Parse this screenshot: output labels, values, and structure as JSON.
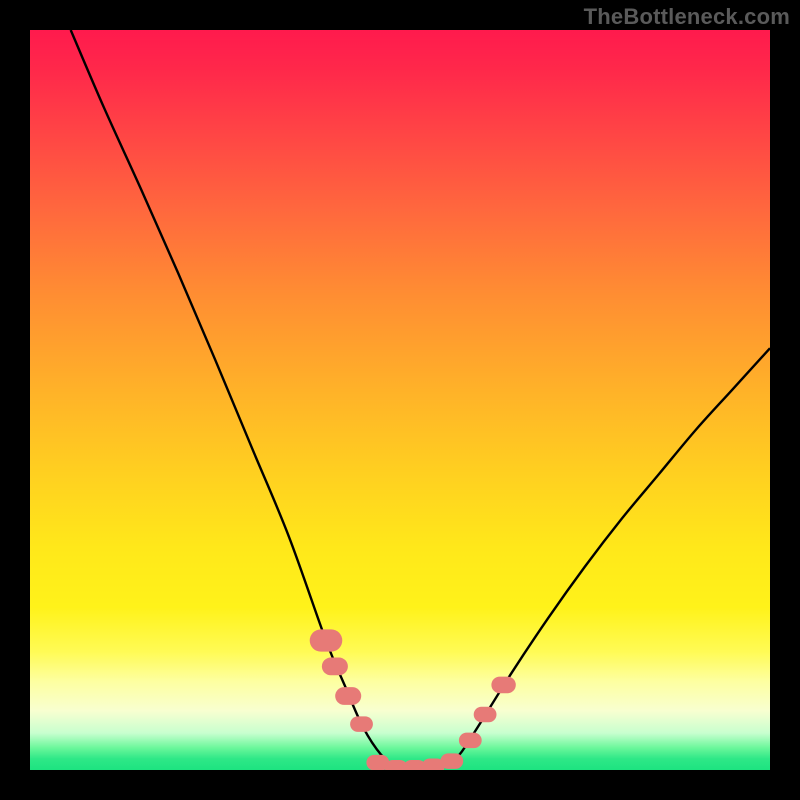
{
  "watermark": "TheBottleneck.com",
  "chart_data": {
    "type": "line",
    "title": "",
    "xlabel": "",
    "ylabel": "",
    "xlim": [
      0,
      1
    ],
    "ylim": [
      0,
      1
    ],
    "series": [
      {
        "name": "curve",
        "x": [
          0.055,
          0.1,
          0.15,
          0.2,
          0.25,
          0.3,
          0.35,
          0.4,
          0.425,
          0.45,
          0.475,
          0.5,
          0.525,
          0.55,
          0.575,
          0.6,
          0.65,
          0.7,
          0.75,
          0.8,
          0.85,
          0.9,
          0.95,
          1.0
        ],
        "y": [
          1.0,
          0.895,
          0.785,
          0.672,
          0.555,
          0.435,
          0.315,
          0.175,
          0.115,
          0.058,
          0.02,
          0.0,
          0.0,
          0.002,
          0.015,
          0.05,
          0.13,
          0.205,
          0.275,
          0.34,
          0.4,
          0.46,
          0.515,
          0.57
        ]
      }
    ],
    "markers": [
      {
        "name": "left-cluster-top",
        "x": 0.4,
        "y": 0.175,
        "r": 0.02
      },
      {
        "name": "left-cluster-mid",
        "x": 0.412,
        "y": 0.14,
        "r": 0.016
      },
      {
        "name": "left-cluster-low",
        "x": 0.43,
        "y": 0.1,
        "r": 0.016
      },
      {
        "name": "left-cluster-lower",
        "x": 0.448,
        "y": 0.062,
        "r": 0.014
      },
      {
        "name": "bottom-bar-a",
        "x": 0.47,
        "y": 0.01,
        "r": 0.014
      },
      {
        "name": "bottom-bar-b",
        "x": 0.495,
        "y": 0.003,
        "r": 0.014
      },
      {
        "name": "bottom-bar-c",
        "x": 0.52,
        "y": 0.003,
        "r": 0.014
      },
      {
        "name": "bottom-bar-d",
        "x": 0.545,
        "y": 0.005,
        "r": 0.014
      },
      {
        "name": "bottom-bar-e",
        "x": 0.57,
        "y": 0.012,
        "r": 0.014
      },
      {
        "name": "right-cluster-low",
        "x": 0.595,
        "y": 0.04,
        "r": 0.014
      },
      {
        "name": "right-cluster-mid",
        "x": 0.615,
        "y": 0.075,
        "r": 0.014
      },
      {
        "name": "right-cluster-top",
        "x": 0.64,
        "y": 0.115,
        "r": 0.015
      }
    ],
    "marker_style": {
      "fill": "#e77a77",
      "stroke": "none"
    },
    "curve_style": {
      "stroke": "#000000",
      "stroke_width": 2.4
    }
  }
}
